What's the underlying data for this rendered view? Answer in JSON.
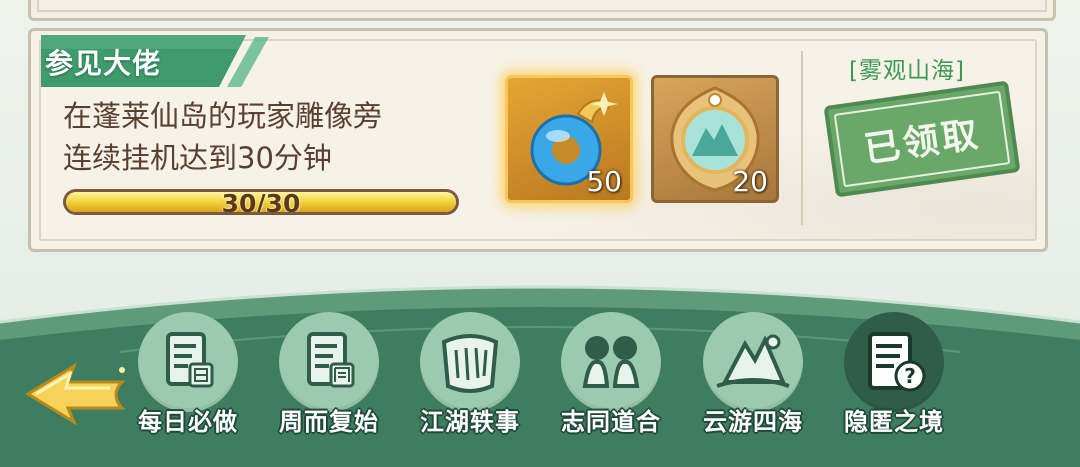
{
  "task": {
    "title": "参见大佬",
    "description_line1": "在蓬莱仙岛的玩家雕像旁",
    "description_line2": "连续挂机达到30分钟",
    "progress_text": "30/30",
    "progress_fraction": 1.0,
    "location_link": "[雾观山海]",
    "status_stamp": "已领取",
    "rewards": [
      {
        "icon": "jade-ring-icon",
        "count": "50"
      },
      {
        "icon": "mountain-medallion-icon",
        "count": "20"
      }
    ]
  },
  "nav": {
    "back_icon": "back-arrow-icon",
    "items": [
      {
        "label": "每日必做",
        "icon": "daily-scroll-icon"
      },
      {
        "label": "周而复始",
        "icon": "weekly-scroll-icon"
      },
      {
        "label": "江湖轶事",
        "icon": "story-scroll-icon"
      },
      {
        "label": "志同道合",
        "icon": "companions-icon"
      },
      {
        "label": "云游四海",
        "icon": "travel-mountain-icon"
      },
      {
        "label": "隐匿之境",
        "icon": "hidden-quest-icon"
      }
    ],
    "active_index": 5
  },
  "colors": {
    "card_bg": "#f6f1e6",
    "title_tab": "#3f9a6c",
    "progress_fill": "#f2d23a",
    "stamp": "#6aa86a",
    "nav_circle": "#9ccab0",
    "nav_active": "#2f5d4a",
    "link_green": "#3c9a55"
  }
}
